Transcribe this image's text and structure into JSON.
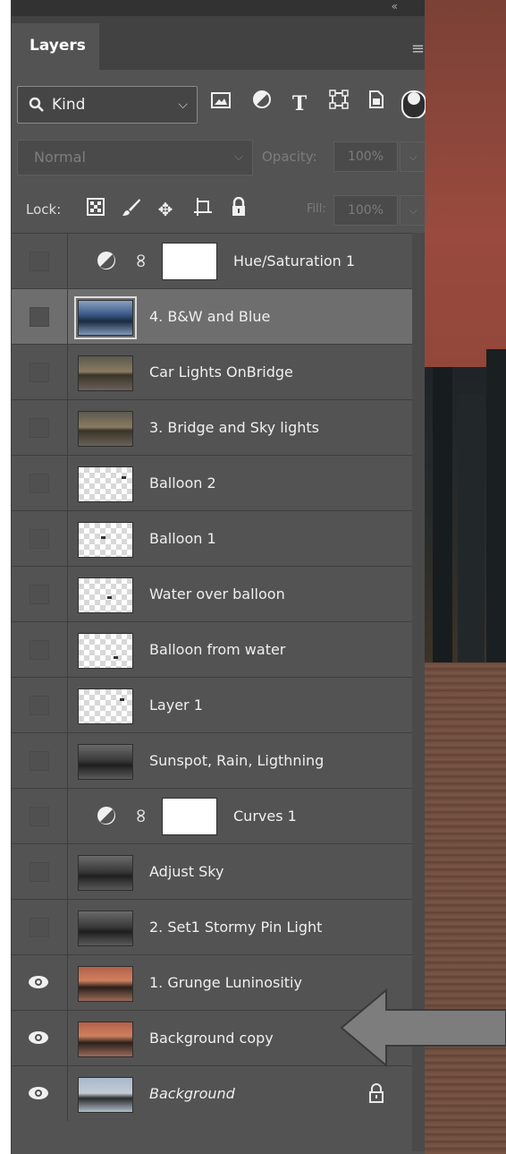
{
  "panel": {
    "tab_label": "Layers",
    "collapse_glyph": "«",
    "menu_glyph": "≡"
  },
  "filter": {
    "kind_label": "Kind",
    "icons": [
      "image-filter-icon",
      "adjustment-filter-icon",
      "type-filter-icon",
      "shape-filter-icon",
      "smart-object-filter-icon",
      "filter-toggle-icon"
    ]
  },
  "blend": {
    "mode": "Normal",
    "opacity_label": "Opacity:",
    "opacity_value": "100%"
  },
  "lock": {
    "label": "Lock:",
    "icons": [
      "lock-transparent-pixels-icon",
      "lock-image-pixels-icon",
      "lock-position-icon",
      "lock-artboard-icon",
      "lock-all-icon"
    ],
    "fill_label": "Fill:",
    "fill_value": "100%"
  },
  "layers": [
    {
      "name": "Hue/Saturation 1",
      "type": "adjustment",
      "visible": false
    },
    {
      "name": "4. B&W and Blue",
      "type": "pixel",
      "thumb": "bw",
      "visible": false,
      "selected": true
    },
    {
      "name": "Car Lights OnBridge",
      "type": "pixel",
      "thumb": "photo1",
      "visible": false
    },
    {
      "name": "3. Bridge and Sky lights",
      "type": "pixel",
      "thumb": "photo1",
      "visible": false
    },
    {
      "name": "Balloon 2",
      "type": "pixel",
      "thumb": "transparent",
      "visible": false
    },
    {
      "name": "Balloon 1",
      "type": "pixel",
      "thumb": "transparent",
      "visible": false
    },
    {
      "name": "Water over balloon",
      "type": "pixel",
      "thumb": "transparent",
      "visible": false
    },
    {
      "name": "Balloon from water",
      "type": "pixel",
      "thumb": "transparent",
      "visible": false
    },
    {
      "name": "Layer 1",
      "type": "pixel",
      "thumb": "transparent",
      "visible": false
    },
    {
      "name": "Sunspot, Rain, Ligthning",
      "type": "pixel",
      "thumb": "stormy",
      "visible": false
    },
    {
      "name": "Curves 1",
      "type": "adjustment",
      "visible": false
    },
    {
      "name": "Adjust Sky",
      "type": "pixel",
      "thumb": "stormy",
      "visible": false
    },
    {
      "name": "2. Set1 Stormy Pin Light",
      "type": "pixel",
      "thumb": "stormy",
      "visible": false
    },
    {
      "name": "1.  Grunge Luninositiy",
      "type": "pixel",
      "thumb": "grunge",
      "visible": true
    },
    {
      "name": "Background copy",
      "type": "pixel",
      "thumb": "grunge",
      "visible": true
    },
    {
      "name": "Background",
      "type": "pixel",
      "thumb": "bg",
      "visible": true,
      "locked": true,
      "italic": true
    }
  ],
  "colors": {
    "panel_bg": "#535353",
    "selected_row": "#6e6e6e",
    "arrow": "#7d7d7d"
  }
}
